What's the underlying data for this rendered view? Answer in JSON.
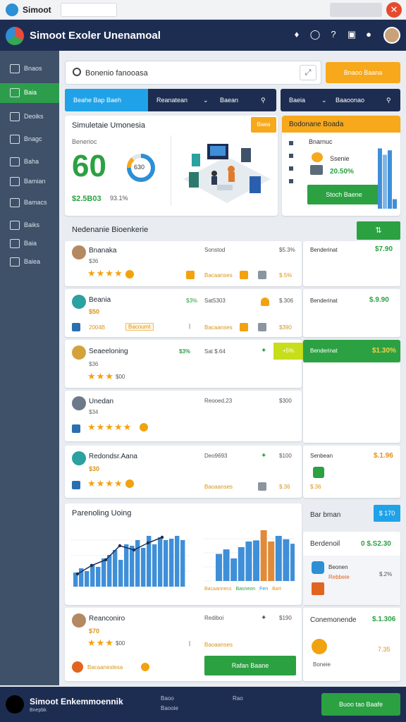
{
  "app": {
    "title": "Simoot",
    "tab": "",
    "window_control": "",
    "close": "✕"
  },
  "header": {
    "brand": "Simoot Exoler Unenamoal",
    "icons": [
      "bell-icon",
      "chat-icon",
      "help-icon",
      "cart-icon",
      "user-icon"
    ]
  },
  "sidebar": {
    "items": [
      {
        "label": "Bnaos",
        "icon": "menu-icon"
      },
      {
        "label": "Baia",
        "icon": "home-icon",
        "active": true
      },
      {
        "label": "Deoiks",
        "icon": "settings-icon"
      },
      {
        "label": "Bnagc",
        "icon": "search-icon"
      },
      {
        "label": "Baha",
        "icon": "calendar-icon"
      },
      {
        "label": "Bamian",
        "icon": "list-icon"
      },
      {
        "label": "Bamacs",
        "icon": "doc-icon"
      },
      {
        "label": "Baiks",
        "icon": "chat-icon"
      },
      {
        "label": "Baia",
        "icon": "link-icon"
      },
      {
        "label": "Baiea",
        "icon": "tag-icon"
      }
    ]
  },
  "search": {
    "value": "Bonenio fanooasa",
    "placeholder": "Bonenio fanooasa",
    "expand_label": "⤢"
  },
  "toolbar": {
    "cta_label": "Bnaoo Baana"
  },
  "tabs": [
    {
      "label": "Beahe Bap Baeh",
      "active": true
    },
    {
      "label": "Reanatean"
    },
    {
      "label": "Baean"
    },
    {
      "label": "Baeia"
    },
    {
      "label": "Baaoonao"
    }
  ],
  "hero": {
    "title": "Simuletaie Umonesia",
    "badge": "Baea",
    "label": "Benerioc",
    "score": "60",
    "donut_value": "630",
    "donut_fraction": 0.78,
    "amount": "$2.5B03",
    "percent": "93.1%"
  },
  "promo": {
    "title": "Bodonane Boada",
    "sub": "Bnarnuc",
    "line1": "Ssenie",
    "line2": "20.50%",
    "button": "Stoch Baene",
    "bars": [
      0.95,
      0.85,
      0.92,
      0.15
    ]
  },
  "section": {
    "title": "Nedenanie Bioenkerie",
    "action": "⇅"
  },
  "rows": [
    {
      "name": "Bnanaka",
      "meta": "$36",
      "col": "Sonstod",
      "val": "$5.3%",
      "tag": "Bacaanses",
      "extra": "$.5%",
      "rating": 4,
      "right_label": "Benderinat",
      "right_price": "$7.90"
    },
    {
      "name": "Beania",
      "meta": "$50",
      "col": "Sat5303",
      "val": "$.306",
      "tag": "Bacaanses",
      "extra": "$390",
      "rating_text": "2004B",
      "sub_tag": "Bacoumt",
      "pct": "$3%",
      "right_label": "Benderinat",
      "right_price": "$.9.90"
    },
    {
      "name": "Seaeeloning",
      "meta": "$36",
      "col": "Sat $.64",
      "val": "$3%",
      "rating": 3,
      "rating_extra": "$00",
      "right_label": "Benderinat",
      "right_price": "$1.30%",
      "badge": "+5%"
    },
    {
      "name": "Unedan",
      "meta": "$34",
      "col": "Reooed.23",
      "val": "$300",
      "rating": 5,
      "right_label": ""
    },
    {
      "name": "Redondsr.Aana",
      "meta": "$30",
      "col": "Deo9693",
      "val": "$100",
      "tag": "Baoaanses",
      "extra": "$.36",
      "rating": 4,
      "right_label": "Senbean",
      "right_price": "$.1.96",
      "right_sub": "$.36"
    }
  ],
  "chart_data": {
    "type": "bar",
    "title": "Parenoling Uoing",
    "series": [
      {
        "values": [
          20,
          26,
          22,
          32,
          28,
          40,
          45,
          52,
          38,
          60,
          58,
          66,
          55,
          72,
          60,
          70,
          66,
          68,
          72,
          66
        ]
      },
      {
        "values": [
          48,
          56,
          40,
          60,
          70,
          72,
          90,
          70,
          80,
          74,
          66
        ]
      }
    ],
    "line_values": [
      18,
      30,
      38,
      58,
      52,
      62,
      70
    ],
    "xlabel_left": "",
    "legend": [
      "Bacaannecs",
      "Basneon",
      "Fen",
      "Bart"
    ]
  },
  "side_panel": {
    "title": "Bar bman",
    "action": "$ 170",
    "card1_label": "Berdenoil",
    "card1_value": "0  $.S2.30",
    "card2_label": "Beonen",
    "card2_sub": "Rebbeie",
    "card2_price": "$.2%",
    "card3_label": "Conemonende",
    "card3_price": "$.1.306",
    "card3_sub": "Boneie",
    "card3_extra": "7.35"
  },
  "bottom_row": {
    "name": "Reanconiro",
    "meta": "$70",
    "col": "Rediboi",
    "val": "$190",
    "rating_extra": "$00",
    "tag": "Baoaanses",
    "footer_tag": "Bacaaneslesa",
    "button": "Rafan Baane"
  },
  "footer": {
    "brand": "Simoot Enkemmoennik",
    "sub": "Bnepbk",
    "links": [
      "Baoo",
      "Baooie",
      "Rao"
    ],
    "button": "Buoo tao Baafe"
  },
  "colors": {
    "navy": "#1d2d52",
    "green": "#2ba142",
    "orange": "#f7a81b",
    "blue": "#2d8fd5"
  }
}
